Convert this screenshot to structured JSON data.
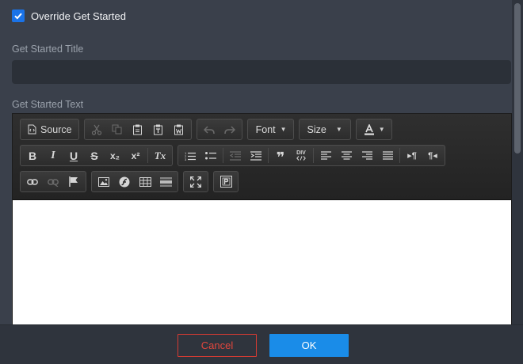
{
  "override": {
    "label": "Override Get Started",
    "checked": true
  },
  "title_field": {
    "label": "Get Started Title",
    "value": "",
    "placeholder": ""
  },
  "text_field": {
    "label": "Get Started Text"
  },
  "toolbar": {
    "source_label": "Source",
    "font_label": "Font",
    "size_label": "Size",
    "bold": "B",
    "italic": "I",
    "underline": "U",
    "strike": "S",
    "subscript": "x₂",
    "superscript": "x²",
    "remove_format": "Tx",
    "blockquote": "❞",
    "div": "DIV",
    "ltr": "▸¶",
    "rtl": "¶◂"
  },
  "colors": {
    "accent": "#1a8ce8",
    "danger": "#d43b33",
    "background": "#3a404b"
  },
  "footer": {
    "cancel_label": "Cancel",
    "ok_label": "OK"
  }
}
